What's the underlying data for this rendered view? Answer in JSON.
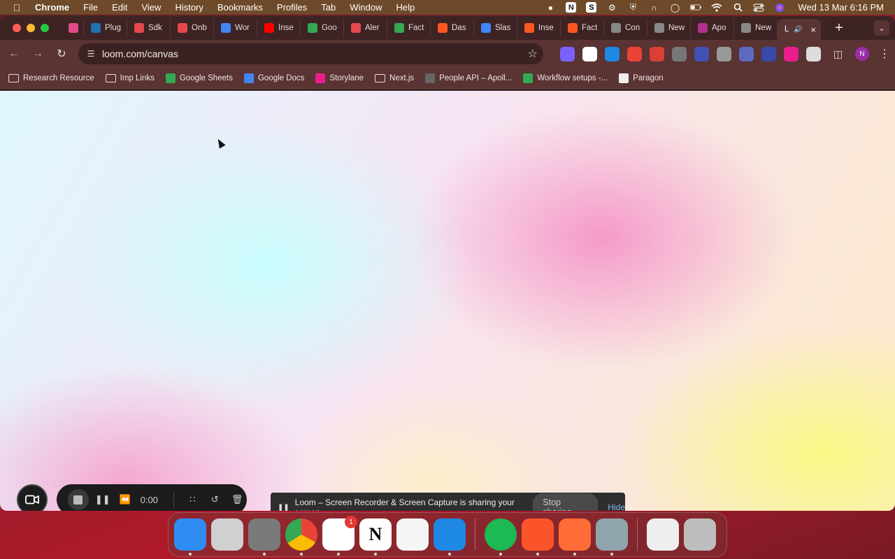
{
  "menubar": {
    "app_name": "Chrome",
    "menus": [
      "File",
      "Edit",
      "View",
      "History",
      "Bookmarks",
      "Profiles",
      "Tab",
      "Window",
      "Help"
    ],
    "status_icons": [
      "video-icon",
      "notion-icon",
      "s-app-icon",
      "gear-icon",
      "shield-icon",
      "airpods-icon",
      "user-icon",
      "battery-icon",
      "wifi-icon",
      "search-icon",
      "control-center-icon",
      "siri-icon"
    ],
    "clock": "Wed 13 Mar  6:16 PM"
  },
  "tabs": [
    {
      "label": "",
      "icon": "loom-icon",
      "color": "#e24a8a"
    },
    {
      "label": "Plug",
      "icon": "wordpress-icon",
      "color": "#2271b1"
    },
    {
      "label": "Sdk",
      "icon": "f-icon",
      "color": "#e5484d"
    },
    {
      "label": "Onb",
      "icon": "f-icon",
      "color": "#e5484d"
    },
    {
      "label": "Wor",
      "icon": "docs-icon",
      "color": "#4285f4"
    },
    {
      "label": "Inse",
      "icon": "youtube-icon",
      "color": "#ff0000"
    },
    {
      "label": "Goo",
      "icon": "drive-icon",
      "color": "#34a853"
    },
    {
      "label": "Aler",
      "icon": "f-icon",
      "color": "#e5484d"
    },
    {
      "label": "Fact",
      "icon": "sheets-icon",
      "color": "#34a853"
    },
    {
      "label": "Das",
      "icon": "square-icon",
      "color": "#ff5722"
    },
    {
      "label": "Slas",
      "icon": "calendar-icon",
      "color": "#4285f4"
    },
    {
      "label": "Inse",
      "icon": "square-icon",
      "color": "#ff5722"
    },
    {
      "label": "Fact",
      "icon": "square-icon",
      "color": "#ff5722"
    },
    {
      "label": "Con",
      "icon": "globe-icon",
      "color": "#888888"
    },
    {
      "label": "New",
      "icon": "chrome-icon",
      "color": "#888888"
    },
    {
      "label": "Apo",
      "icon": "apollo-icon",
      "color": "#b0308e"
    },
    {
      "label": "New",
      "icon": "chrome-icon",
      "color": "#888888"
    },
    {
      "label": "L",
      "icon": "speaker-icon",
      "color": "#cccccc",
      "active": true
    }
  ],
  "toolbar": {
    "url": "loom.com/canvas",
    "extensions": [
      {
        "icon": "sparkle-icon",
        "color": "#7b61ff"
      },
      {
        "icon": "notion-icon",
        "color": "#ffffff"
      },
      {
        "icon": "c-icon",
        "color": "#1e88e5"
      },
      {
        "icon": "chrome-store-icon",
        "color": "#ea4335"
      },
      {
        "icon": "todoist-icon",
        "color": "#db4035"
      },
      {
        "icon": "lines-icon",
        "color": "#777777"
      },
      {
        "icon": "ring-icon",
        "color": "#3f51b5"
      },
      {
        "icon": "camera-icon",
        "color": "#999999"
      },
      {
        "icon": "db-icon",
        "color": "#5c6bc0"
      },
      {
        "icon": "wave-icon",
        "color": "#3949ab"
      },
      {
        "icon": "storylane-icon",
        "color": "#e91e8c"
      },
      {
        "icon": "puzzle-icon",
        "color": "#dddddd"
      }
    ],
    "profile_initial": "N"
  },
  "bookmarks": [
    {
      "label": "Research Resource",
      "icon": "folder-icon"
    },
    {
      "label": "Imp Links",
      "icon": "folder-icon"
    },
    {
      "label": "Google Sheets",
      "icon": "sheets-icon",
      "color": "#34a853"
    },
    {
      "label": "Google Docs",
      "icon": "docs-icon",
      "color": "#4285f4"
    },
    {
      "label": "Storylane",
      "icon": "storylane-icon",
      "color": "#e91e8c"
    },
    {
      "label": "Next.js",
      "icon": "folder-icon"
    },
    {
      "label": "People API – Apoll...",
      "icon": "globe-icon",
      "color": "#666666"
    },
    {
      "label": "Workflow setups -...",
      "icon": "sheets-icon",
      "color": "#34a853"
    },
    {
      "label": "Paragon",
      "icon": "paragon-icon",
      "color": "#eeeeee"
    }
  ],
  "recorder": {
    "time": "0:00"
  },
  "share_banner": {
    "message": "Loom – Screen Recorder & Screen Capture is sharing your screen.",
    "stop_label": "Stop sharing",
    "hide_label": "Hide"
  },
  "dock": [
    {
      "name": "finder",
      "color": "#2f8cf0",
      "label": "",
      "running": true
    },
    {
      "name": "launchpad",
      "color": "#d0d0d0",
      "label": "",
      "running": false
    },
    {
      "name": "system-settings",
      "color": "#7a7a7a",
      "label": "",
      "running": true
    },
    {
      "name": "chrome",
      "color": "#eeeeee",
      "label": "",
      "running": true
    },
    {
      "name": "slack",
      "color": "#ffffff",
      "label": "",
      "running": true,
      "badge": "1"
    },
    {
      "name": "notion",
      "color": "#ffffff",
      "label": "N",
      "running": true
    },
    {
      "name": "freeform",
      "color": "#f5f5f5",
      "label": "",
      "running": false
    },
    {
      "name": "vscode",
      "color": "#1e88e5",
      "label": "",
      "running": true
    },
    {
      "name": "spotify",
      "color": "#1db954",
      "label": "",
      "running": true
    },
    {
      "name": "brave",
      "color": "#fb542b",
      "label": "",
      "running": true
    },
    {
      "name": "postman",
      "color": "#ff6c37",
      "label": "",
      "running": true
    },
    {
      "name": "preview",
      "color": "#90a4ae",
      "label": "",
      "running": true
    },
    {
      "name": "csv-file",
      "color": "#eeeeee",
      "label": "",
      "running": false
    },
    {
      "name": "trash",
      "color": "#bdbdbd",
      "label": "",
      "running": false
    }
  ]
}
